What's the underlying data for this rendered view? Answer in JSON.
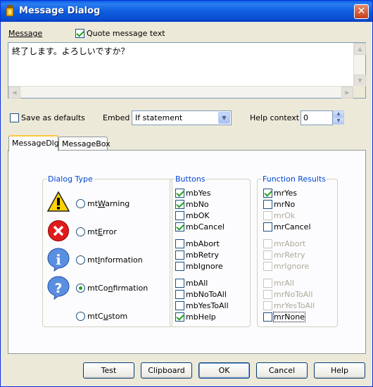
{
  "window": {
    "title": "Message Dialog",
    "close_glyph": "✕"
  },
  "message": {
    "label": "Message",
    "quote_label": "Quote message text",
    "quote_checked": true,
    "text": "終了します。よろしいですか？"
  },
  "options": {
    "save_defaults_label": "Save as defaults",
    "save_defaults_checked": false,
    "embed_label": "Embed",
    "embed_value": "If statement",
    "help_context_label": "Help context",
    "help_context_value": "0"
  },
  "tabs": [
    {
      "label": "MessageDlg",
      "active": true
    },
    {
      "label": "MessageBox",
      "active": false
    }
  ],
  "dialog_type": {
    "title": "Dialog Type",
    "items": [
      {
        "label": "mtWarning",
        "icon": "warning-icon",
        "checked": false
      },
      {
        "label": "mtError",
        "icon": "error-icon",
        "checked": false
      },
      {
        "label": "mtInformation",
        "icon": "information-icon",
        "checked": false
      },
      {
        "label": "mtConfirmation",
        "icon": "confirmation-icon",
        "checked": true
      },
      {
        "label": "mtCustom",
        "icon": "",
        "checked": false
      }
    ]
  },
  "buttons_group": {
    "title": "Buttons",
    "items": [
      {
        "label": "mbYes",
        "checked": true
      },
      {
        "label": "mbNo",
        "checked": true
      },
      {
        "label": "mbOK",
        "checked": false
      },
      {
        "label": "mbCancel",
        "checked": true
      },
      {
        "label": "mbAbort",
        "checked": false
      },
      {
        "label": "mbRetry",
        "checked": false
      },
      {
        "label": "mbIgnore",
        "checked": false
      },
      {
        "label": "mbAll",
        "checked": false
      },
      {
        "label": "mbNoToAll",
        "checked": false
      },
      {
        "label": "mbYesToAll",
        "checked": false
      },
      {
        "label": "mbHelp",
        "checked": true
      }
    ]
  },
  "function_results": {
    "title": "Function Results",
    "items": [
      {
        "label": "mrYes",
        "checked": true,
        "enabled": true
      },
      {
        "label": "mrNo",
        "checked": false,
        "enabled": true
      },
      {
        "label": "mrOk",
        "checked": false,
        "enabled": false
      },
      {
        "label": "mrCancel",
        "checked": false,
        "enabled": true
      },
      {
        "label": "mrAbort",
        "checked": false,
        "enabled": false
      },
      {
        "label": "mrRetry",
        "checked": false,
        "enabled": false
      },
      {
        "label": "mrIgnore",
        "checked": false,
        "enabled": false
      },
      {
        "label": "mrAll",
        "checked": false,
        "enabled": false
      },
      {
        "label": "mrNoToAll",
        "checked": false,
        "enabled": false
      },
      {
        "label": "mrYesToAll",
        "checked": false,
        "enabled": false
      },
      {
        "label": "mrNone",
        "checked": false,
        "enabled": true
      }
    ]
  },
  "footer": {
    "test": "Test",
    "clipboard": "Clipboard",
    "ok": "OK",
    "cancel": "Cancel",
    "help": "Help"
  },
  "colors": {
    "title_bar": "#0a5fe6",
    "group_title": "#0046d5",
    "check_mark": "#21a121",
    "dialog_bg": "#ece9d8"
  }
}
